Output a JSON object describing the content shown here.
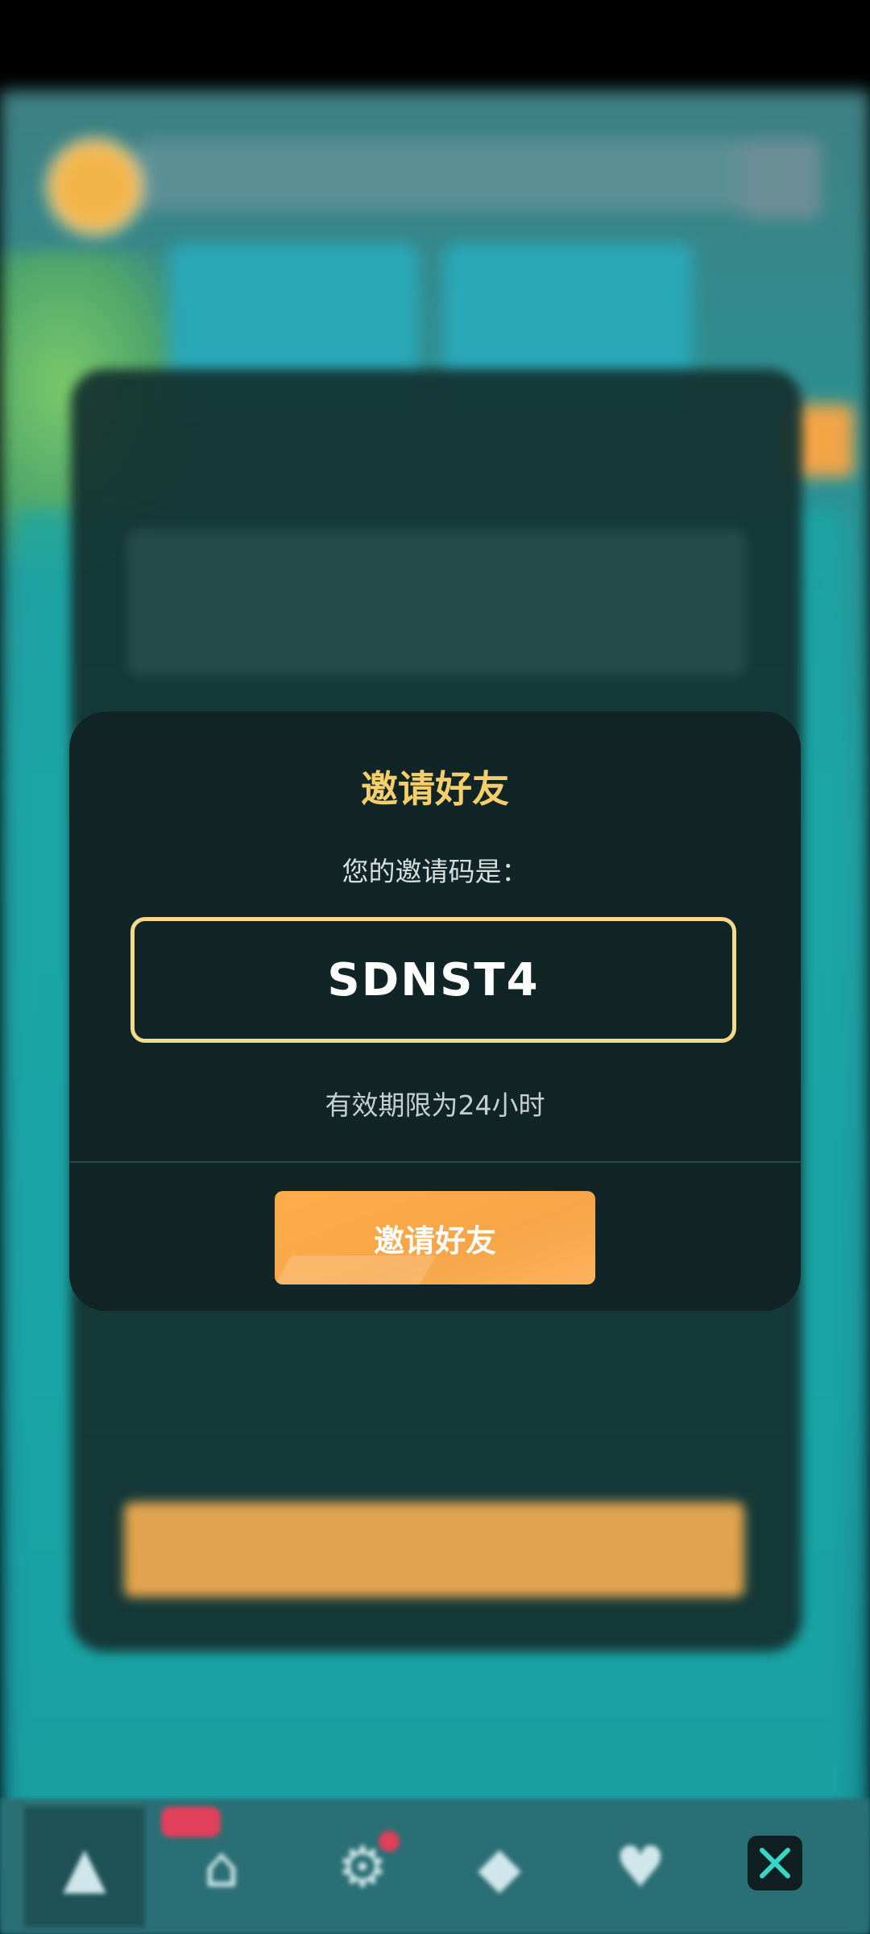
{
  "modal": {
    "title": "邀请好友",
    "subtitle": "您的邀请码是：",
    "code": "SDNST4",
    "validity": "有效期限为24小时",
    "button_label": "邀请好友"
  },
  "colors": {
    "title": "#f6cf6a",
    "code_border": "#f6d98b",
    "button": "#f7a548",
    "modal_bg": "#112527"
  },
  "icons": {
    "close": "close-icon",
    "nav": [
      "home-icon",
      "shop-icon",
      "settings-icon",
      "gem-icon",
      "heart-icon"
    ]
  }
}
